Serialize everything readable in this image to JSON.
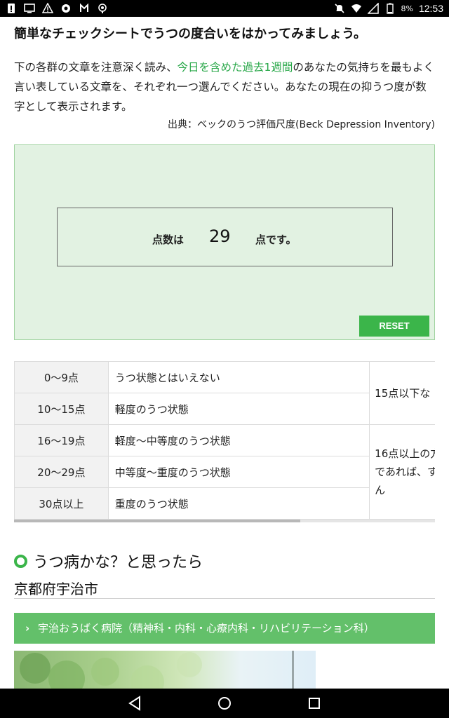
{
  "status_bar": {
    "time": "12:53",
    "battery_percent": "8%",
    "left_icons": [
      "alert-icon",
      "cast-icon",
      "warning-icon",
      "sync-icon",
      "data-icon",
      "location-icon"
    ],
    "right_icons": [
      "mute-icon",
      "wifi-icon",
      "signal-icon",
      "battery-icon"
    ]
  },
  "article": {
    "headline": "簡単なチェックシートでうつの度合いをはかってみましょう。",
    "intro_before": "下の各群の文章を注意深く読み、",
    "intro_highlight": "今日を含めた過去1週間",
    "intro_after": "のあなたの気持ちを最もよく言い表している文章を、それぞれ一つ選んでください。あなたの現在の抑うつ度が数字として表示されます。",
    "source": "出典：ベックのうつ評価尺度(Beck Depression Inventory)"
  },
  "score": {
    "prefix": "点数は",
    "value": "29",
    "suffix": "点です。",
    "reset_label": "RESET"
  },
  "colors": {
    "accent_green": "#3bb54a",
    "panel_bg": "#e2f2e2",
    "link_green": "#2aa84a"
  },
  "score_table": {
    "rows": [
      {
        "range": "0〜9点",
        "desc": "うつ状態とはいえない"
      },
      {
        "range": "10〜15点",
        "desc": "軽度のうつ状態"
      },
      {
        "range": "16〜19点",
        "desc": "軽度〜中等度のうつ状態"
      },
      {
        "range": "20〜29点",
        "desc": "中等度〜重度のうつ状態"
      },
      {
        "range": "30点以上",
        "desc": "重度のうつ状態"
      }
    ],
    "notes": [
      {
        "lines": [
          "15点以下な"
        ]
      },
      {
        "lines": [
          "16点以上の方",
          "であれば、す",
          "ん"
        ]
      }
    ],
    "horizontal_scroll_fraction": 0.68
  },
  "section": {
    "title": "うつ病かな？と思ったら",
    "city": "京都府宇治市",
    "hospital_link": "宇治おうばく病院（精神科・内科・心療内科・リハビリテーション科）"
  },
  "nav_bar": {
    "buttons": [
      "back-icon",
      "home-icon",
      "recents-icon"
    ]
  }
}
